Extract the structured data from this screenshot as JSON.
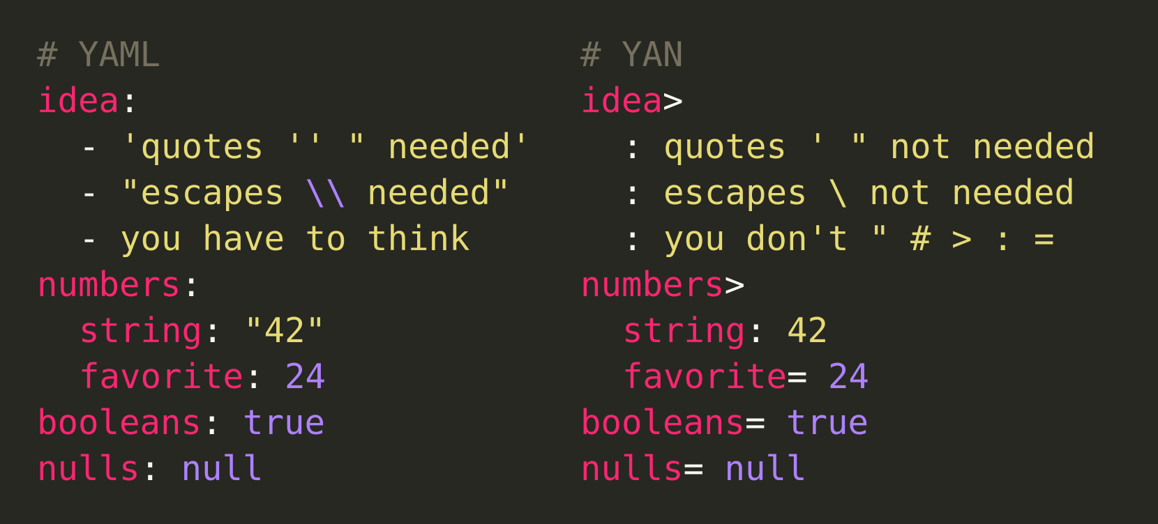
{
  "yaml": {
    "heading": "# YAML",
    "idea_key": "idea",
    "idea_sep": ":",
    "items": {
      "dash": "- ",
      "quotes": "'quotes '' \" needed'",
      "escapes_open": "\"escapes ",
      "escapes_bs": "\\\\",
      "escapes_close": " needed\"",
      "think": "you have to think"
    },
    "numbers_key": "numbers",
    "numbers_sep": ":",
    "string_key": "string",
    "string_sep": ": ",
    "string_val": "\"42\"",
    "favorite_key": "favorite",
    "favorite_sep": ": ",
    "favorite_val": "24",
    "booleans_key": "booleans",
    "booleans_sep": ": ",
    "booleans_val": "true",
    "nulls_key": "nulls",
    "nulls_sep": ": ",
    "nulls_val": "null"
  },
  "yan": {
    "heading": "# YAN",
    "idea_key": "idea",
    "idea_sep": ">",
    "items": {
      "colon": ": ",
      "quotes": "quotes ' \" not needed",
      "escapes": "escapes \\ not needed",
      "dont": "you don't \" # > : ="
    },
    "numbers_key": "numbers",
    "numbers_sep": ">",
    "string_key": "string",
    "string_sep": ": ",
    "string_val": "42",
    "favorite_key": "favorite",
    "favorite_sep": "= ",
    "favorite_val": "24",
    "booleans_key": "booleans",
    "booleans_sep": "= ",
    "booleans_val": "true",
    "nulls_key": "nulls",
    "nulls_sep": "= ",
    "nulls_val": "null"
  },
  "colors": {
    "background": "#272822",
    "comment": "#75715e",
    "key": "#f92672",
    "punctuation": "#f8f8f2",
    "string": "#e6db74",
    "constant": "#ae81ff"
  }
}
